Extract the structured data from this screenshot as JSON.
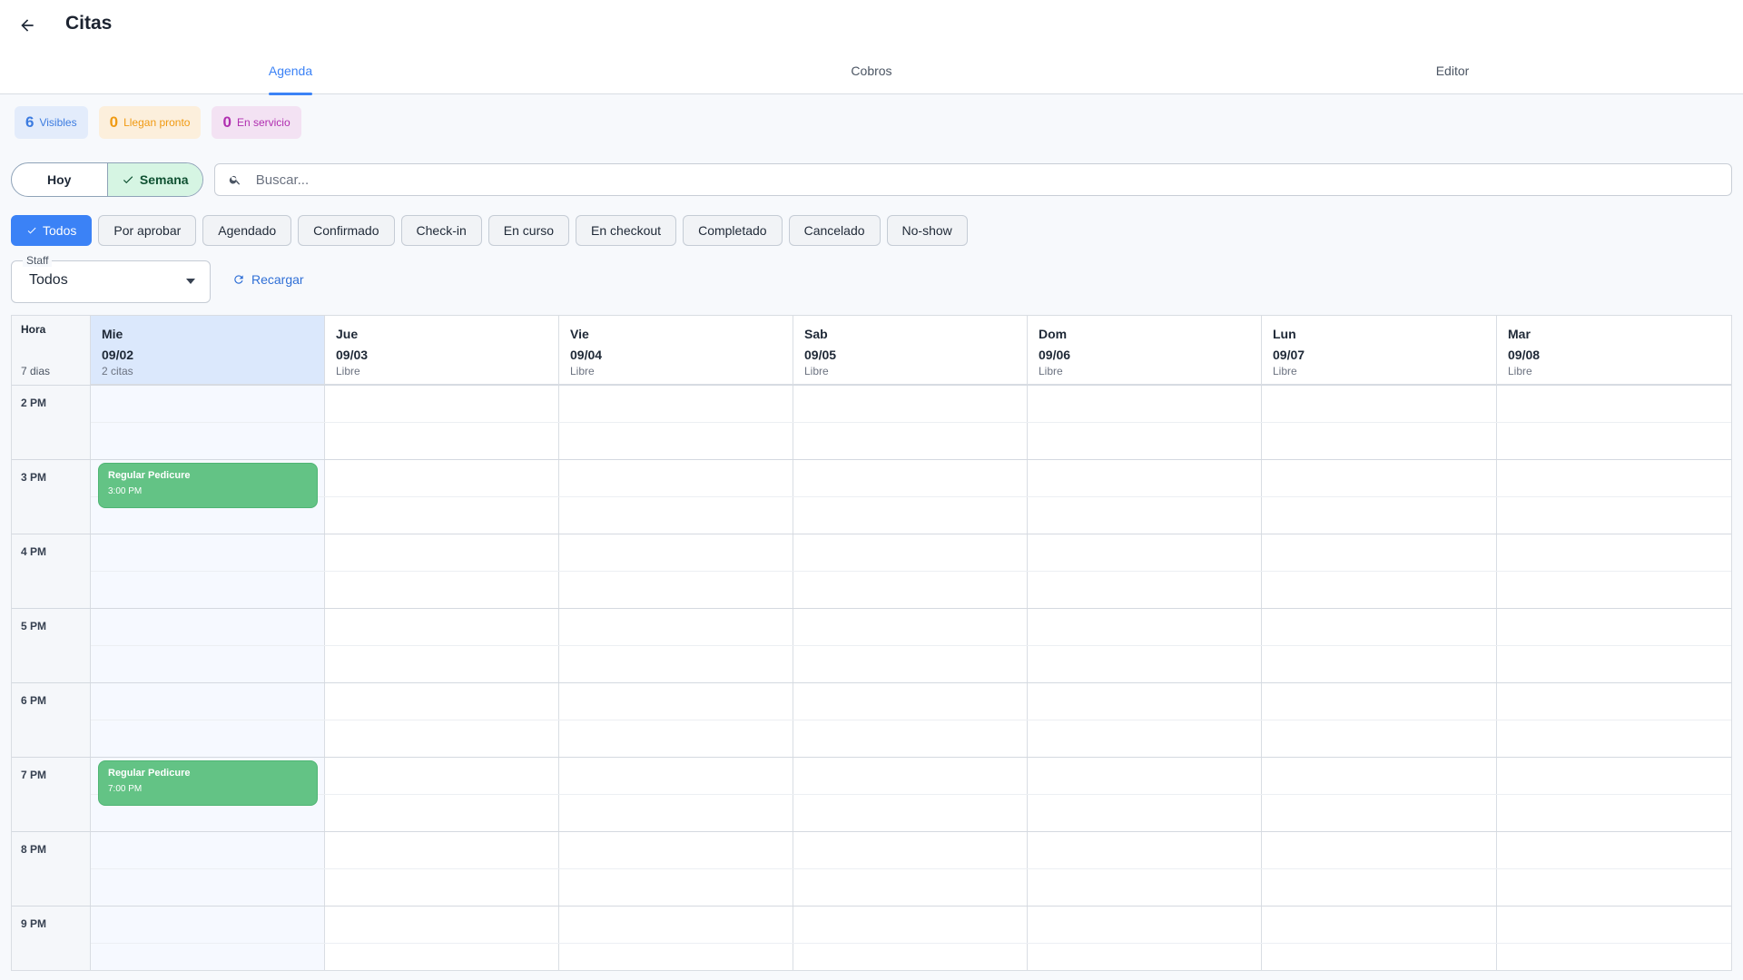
{
  "header": {
    "title": "Citas"
  },
  "tabs": [
    {
      "label": "Agenda"
    },
    {
      "label": "Cobros"
    },
    {
      "label": "Editor"
    }
  ],
  "stats": [
    {
      "count": "6",
      "label": "Visibles"
    },
    {
      "count": "0",
      "label": "Llegan pronto"
    },
    {
      "count": "0",
      "label": "En servicio"
    }
  ],
  "view_toggle": {
    "today": "Hoy",
    "week": "Semana"
  },
  "search": {
    "placeholder": "Buscar..."
  },
  "filters": [
    "Todos",
    "Por aprobar",
    "Agendado",
    "Confirmado",
    "Check-in",
    "En curso",
    "En checkout",
    "Completado",
    "Cancelado",
    "No-show"
  ],
  "staff": {
    "label": "Staff",
    "value": "Todos"
  },
  "reload": {
    "label": "Recargar"
  },
  "calendar": {
    "hour_header": "Hora",
    "range_label": "7 dias",
    "hours": [
      "2 PM",
      "3 PM",
      "4 PM",
      "5 PM",
      "6 PM",
      "7 PM",
      "8 PM",
      "9 PM"
    ],
    "days": [
      {
        "name": "Mie",
        "date": "09/02",
        "status": "2 citas"
      },
      {
        "name": "Jue",
        "date": "09/03",
        "status": "Libre"
      },
      {
        "name": "Vie",
        "date": "09/04",
        "status": "Libre"
      },
      {
        "name": "Sab",
        "date": "09/05",
        "status": "Libre"
      },
      {
        "name": "Dom",
        "date": "09/06",
        "status": "Libre"
      },
      {
        "name": "Lun",
        "date": "09/07",
        "status": "Libre"
      },
      {
        "name": "Mar",
        "date": "09/08",
        "status": "Libre"
      }
    ],
    "events": [
      {
        "title": "Regular Pedicure",
        "time": "3:00 PM"
      },
      {
        "title": "Regular Pedicure",
        "time": "7:00 PM"
      }
    ]
  },
  "colors": {
    "accent": "#3b82f6",
    "event_green": "#63c385",
    "today_bg": "#dbe8fc"
  }
}
